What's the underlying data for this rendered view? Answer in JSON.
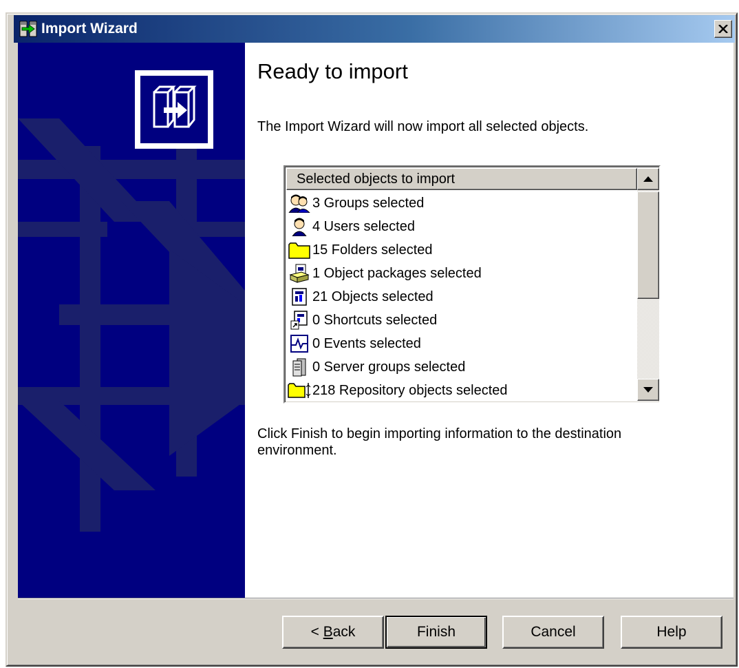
{
  "window": {
    "title": "Import Wizard"
  },
  "content": {
    "heading": "Ready to import",
    "intro": "The Import Wizard will now import all selected objects.",
    "finish_note": "Click Finish to begin importing information to the destination environment."
  },
  "list": {
    "header": "Selected objects to import",
    "items": [
      {
        "label": "3 Groups selected",
        "icon": "groups-icon"
      },
      {
        "label": "4 Users selected",
        "icon": "user-icon"
      },
      {
        "label": "15 Folders selected",
        "icon": "folder-icon"
      },
      {
        "label": "1 Object packages selected",
        "icon": "package-icon"
      },
      {
        "label": "21 Objects selected",
        "icon": "object-icon"
      },
      {
        "label": "0 Shortcuts selected",
        "icon": "shortcut-icon"
      },
      {
        "label": "0 Events selected",
        "icon": "event-icon"
      },
      {
        "label": "0 Server groups selected",
        "icon": "server-icon"
      },
      {
        "label": "218 Repository objects selected",
        "icon": "repository-icon"
      }
    ]
  },
  "buttons": {
    "back_prefix": "< ",
    "back_mnemonic": "B",
    "back_rest": "ack",
    "finish": "Finish",
    "cancel": "Cancel",
    "help": "Help"
  },
  "colors": {
    "side_panel": "#000080",
    "titlebar_start": "#0a246a",
    "titlebar_end": "#a6caf0",
    "face": "#d4d0c8"
  }
}
